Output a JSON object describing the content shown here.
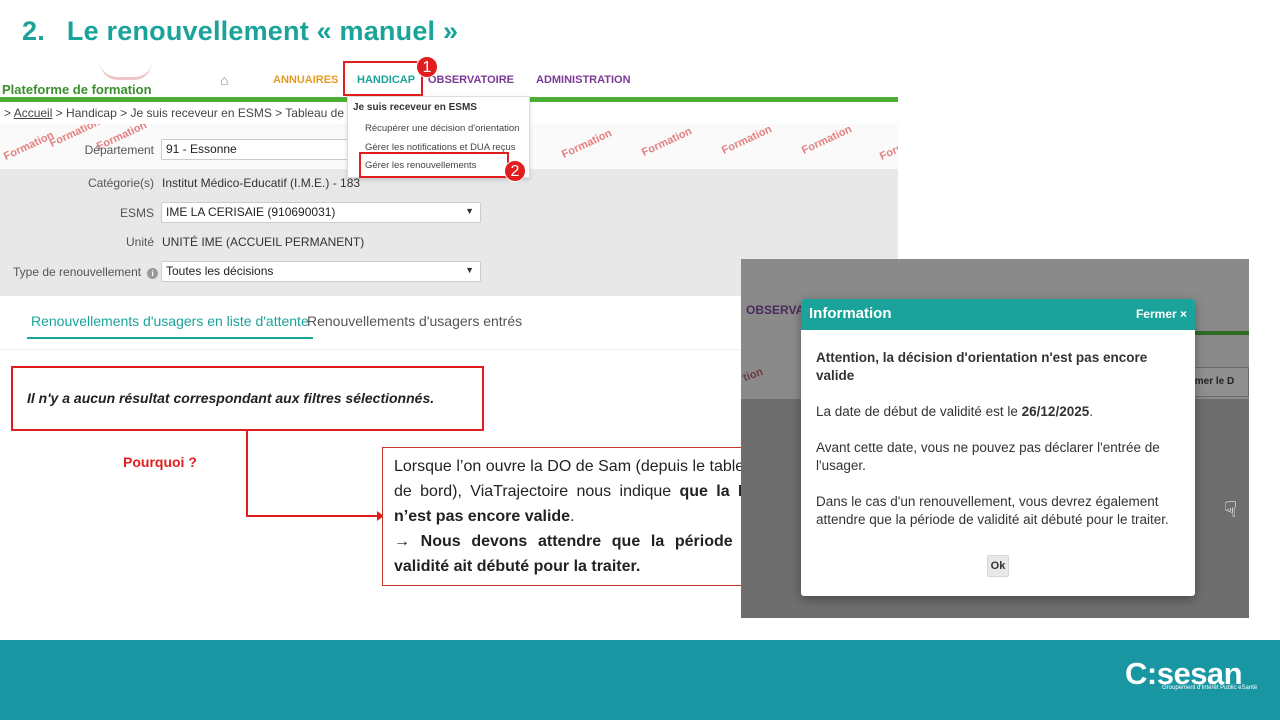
{
  "slide": {
    "title_num": "2.",
    "title_text": "Le renouvellement « manuel »"
  },
  "app": {
    "brand": "Plateforme de formation",
    "nav": {
      "annuaires": "ANNUAIRES",
      "handicap": "HANDICAP",
      "observatoire": "OBSERVATOIRE",
      "administration": "ADMINISTRATION"
    },
    "breadcrumb": {
      "prefix": ">",
      "accueil": "Accueil",
      "rest": "> Handicap > Je suis receveur en ESMS > Tableau de bord d"
    },
    "dropdown": {
      "header": "Je suis receveur en ESMS",
      "items": [
        "Récupérer une décision d'orientation",
        "Gérer les notifications et DUA reçus",
        "Gérer les renouvellements"
      ]
    },
    "filters": {
      "departement_label": "Département",
      "departement_value": "91 - Essonne",
      "categorie_label": "Catégorie(s)",
      "categorie_value": "Institut Médico-Educatif (I.M.E.) - 183",
      "esms_label": "ESMS",
      "esms_value": "IME LA CERISAIE (910690031)",
      "unite_label": "Unité",
      "unite_value": "UNITÉ IME (ACCUEIL PERMANENT)",
      "type_label": "Type de renouvellement",
      "type_value": "Toutes les décisions"
    },
    "watermark": "Formation",
    "tabs": [
      "Renouvellements d'usagers en liste d'attente",
      "Renouvellements d'usagers entrés"
    ]
  },
  "markers": [
    "1",
    "2"
  ],
  "no_result": "Il n'y a aucun résultat correspondant aux filtres sélectionnés.",
  "pourquoi": "Pourquoi  ?",
  "explanation": {
    "part1": "Lorsque l’on ouvre la DO de Sam (depuis le tableau de bord), ViaTrajectoire nous indique ",
    "bold1": "que la DO n’est pas encore valide",
    "part2": ".",
    "arrow": "→",
    "bold2": " Nous devons attendre que la période de validité ait débuté pour la traiter."
  },
  "screenshot_bg": {
    "obs": "OBSERVA",
    "btn": "primer le D",
    "wm": "tion"
  },
  "modal": {
    "title": "Information",
    "close": "Fermer ×",
    "warning": "Attention, la décision d'orientation n'est pas encore valide",
    "date_prefix": "La date de début de validité est le ",
    "date": "26/12/2025",
    "date_suffix": ".",
    "before": "Avant cette date, vous ne pouvez pas déclarer l'entrée de l'usager.",
    "renewal": "Dans le cas d'un renouvellement, vous devrez également attendre que la période de validité ait débuté pour le traiter.",
    "ok": "Ok"
  },
  "footer": {
    "logo": "C:sesan",
    "tagline": "Groupement d'Intérêt Public eSanté"
  },
  "colors": {
    "teal": "#1aa39a",
    "red": "#e11d1d",
    "green": "#4cae33",
    "purple": "#7b3a96",
    "orange": "#e39b25",
    "footer": "#1896a1"
  }
}
